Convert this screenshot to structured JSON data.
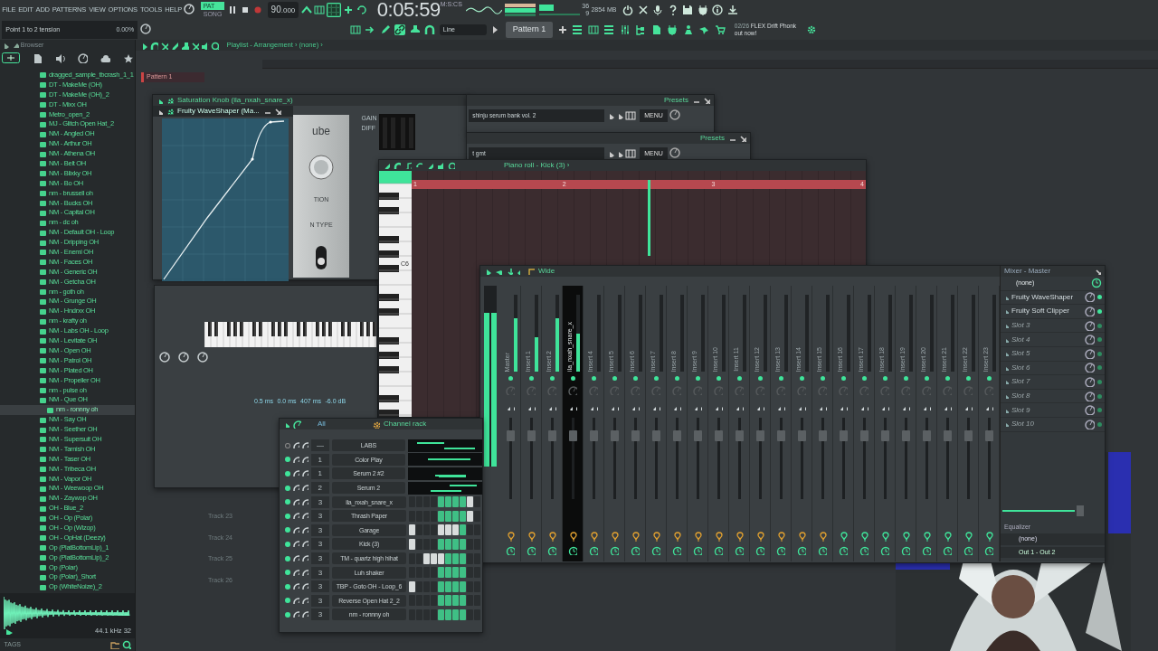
{
  "menu": [
    "FILE",
    "EDIT",
    "ADD",
    "PATTERNS",
    "VIEW",
    "OPTIONS",
    "TOOLS",
    "HELP"
  ],
  "transport": {
    "mode_pattern": "PAT",
    "mode_song": "SONG",
    "pattern_mode": true,
    "recording": false,
    "tempo": "90",
    "tempo_decimals": ".000",
    "time": "0:05:59",
    "time_unit": "M:S:CS",
    "cpu": "36",
    "memory": "2854 MB",
    "polyphony": "9"
  },
  "hint": {
    "title": "Point 1 to 2 tension",
    "value": "0.00%"
  },
  "snap": "Line",
  "pattern": "Pattern 1",
  "news": {
    "date": "02/26",
    "text": "FLEX Drift Phonk out now!"
  },
  "browser": {
    "title": "Browser",
    "items": [
      {
        "name": "dragged_sample_tbcrash_1_1",
        "selected": false
      },
      {
        "name": "DT - MakeMe (OH)",
        "selected": false
      },
      {
        "name": "DT - MakeMe (OH)_2",
        "selected": false
      },
      {
        "name": "DT - Mixx OH",
        "selected": false
      },
      {
        "name": "Metro_open_2",
        "selected": false
      },
      {
        "name": "MJ - Glitch Open Hat_2",
        "selected": false
      },
      {
        "name": "NM - Angled OH",
        "selected": false
      },
      {
        "name": "NM - Arthur OH",
        "selected": false
      },
      {
        "name": "NM - Athena OH",
        "selected": false
      },
      {
        "name": "NM - Belt OH",
        "selected": false
      },
      {
        "name": "NM - Blixky OH",
        "selected": false
      },
      {
        "name": "NM - Bo OH",
        "selected": false
      },
      {
        "name": "nm - brussell oh",
        "selected": false
      },
      {
        "name": "NM - Bucks OH",
        "selected": false
      },
      {
        "name": "NM - Capital OH",
        "selected": false
      },
      {
        "name": "nm - dc oh",
        "selected": false
      },
      {
        "name": "NM - Default OH - Loop",
        "selected": false
      },
      {
        "name": "NM - Dripping OH",
        "selected": false
      },
      {
        "name": "NM - Enemi OH",
        "selected": false
      },
      {
        "name": "NM - Faces OH",
        "selected": false
      },
      {
        "name": "NM - Generic OH",
        "selected": false
      },
      {
        "name": "NM - Getcha OH",
        "selected": false
      },
      {
        "name": "nm - goth oh",
        "selected": false
      },
      {
        "name": "NM - Grunge OH",
        "selected": false
      },
      {
        "name": "NM - Hndrxx OH",
        "selected": false
      },
      {
        "name": "nm - krafty oh",
        "selected": false
      },
      {
        "name": "NM - Labs OH - Loop",
        "selected": false
      },
      {
        "name": "NM - Levitate OH",
        "selected": false
      },
      {
        "name": "NM - Open OH",
        "selected": false
      },
      {
        "name": "NM - Patrol OH",
        "selected": false
      },
      {
        "name": "NM - Plated OH",
        "selected": false
      },
      {
        "name": "NM - Propeller OH",
        "selected": false
      },
      {
        "name": "nm - pulse oh",
        "selected": false
      },
      {
        "name": "NM - Que OH",
        "selected": false
      },
      {
        "name": "nm - ronnny oh",
        "selected": true
      },
      {
        "name": "NM - Say OH",
        "selected": false
      },
      {
        "name": "NM - Seether OH",
        "selected": false
      },
      {
        "name": "NM - Supersuit OH",
        "selected": false
      },
      {
        "name": "NM - Tarnish OH",
        "selected": false
      },
      {
        "name": "NM - Taser OH",
        "selected": false
      },
      {
        "name": "NM - Tribeca OH",
        "selected": false
      },
      {
        "name": "NM - Vapor OH",
        "selected": false
      },
      {
        "name": "NM - Weewoop OH",
        "selected": false
      },
      {
        "name": "NM - Zaywop OH",
        "selected": false
      },
      {
        "name": "OH - Blue_2",
        "selected": false
      },
      {
        "name": "OH - Op (Polar)",
        "selected": false
      },
      {
        "name": "OH - Op (Wizop)",
        "selected": false
      },
      {
        "name": "OH - OpHat (Deezy)",
        "selected": false
      },
      {
        "name": "Op (PlatBottomLip)_1",
        "selected": false
      },
      {
        "name": "Op (PlatBottomLip)_2",
        "selected": false
      },
      {
        "name": "Op (Polar)",
        "selected": false
      },
      {
        "name": "Op (Polar)_Short",
        "selected": false
      },
      {
        "name": "Op (WhiteNoize)_2",
        "selected": false
      }
    ],
    "sample_rate": "44.1 kHz 32",
    "tags": "TAGS"
  },
  "playlist": {
    "title": "Playlist - Arrangement ›",
    "breadcrumb": "(none) ›",
    "clip": "Pattern 1",
    "tracks": [
      "Track 23",
      "Track 24",
      "Track 25",
      "Track 26"
    ]
  },
  "waveshaper": {
    "title": "Saturation Knob (ila_nxah_snare_x)",
    "plugin": "Fruity WaveShaper (Ma...",
    "panel_texts": [
      "ube",
      "TION",
      "N TYPE"
    ],
    "meter_labels": [
      "GAIN",
      "DIFF"
    ]
  },
  "presets": [
    {
      "title": "Presets",
      "menu": "MENU",
      "preset": "shinju serum bank vol. 2"
    },
    {
      "title": "Presets",
      "menu": "MENU",
      "preset": "t gmt"
    }
  ],
  "piano_roll": {
    "title": "Piano roll - Kick (3) ›",
    "bars": [
      "1",
      "2",
      "3",
      "4"
    ],
    "key_label": "C6"
  },
  "envelope": {
    "values": [
      "0.5 ms",
      "0.0 ms",
      "407 ms",
      "-6.0 dB"
    ]
  },
  "mixer": {
    "title": "Wide",
    "panel_title": "Mixer - Master",
    "output_meter": {
      "level": 0.85
    },
    "strips": [
      {
        "name": "Master",
        "level": 0.7,
        "selected": false,
        "routed": true
      },
      {
        "name": "Insert 1",
        "level": 0.45,
        "selected": false,
        "routed": true
      },
      {
        "name": "Insert 2",
        "level": 0.7,
        "selected": false,
        "routed": true
      },
      {
        "name": "ila_nxah_snare_x",
        "level": 0.5,
        "selected": true,
        "routed": true
      },
      {
        "name": "Insert 4",
        "level": 0,
        "selected": false,
        "routed": true
      },
      {
        "name": "Insert 5",
        "level": 0,
        "selected": false,
        "routed": true
      },
      {
        "name": "Insert 6",
        "level": 0,
        "selected": false,
        "routed": true
      },
      {
        "name": "Insert 7",
        "level": 0,
        "selected": false,
        "routed": true
      },
      {
        "name": "Insert 8",
        "level": 0,
        "selected": false,
        "routed": true
      },
      {
        "name": "Insert 9",
        "level": 0,
        "selected": false,
        "routed": true
      },
      {
        "name": "Insert 10",
        "level": 0,
        "selected": false,
        "routed": true
      },
      {
        "name": "Insert 11",
        "level": 0,
        "selected": false,
        "routed": true
      },
      {
        "name": "Insert 12",
        "level": 0,
        "selected": false,
        "routed": true
      },
      {
        "name": "Insert 13",
        "level": 0,
        "selected": false,
        "routed": true
      },
      {
        "name": "Insert 14",
        "level": 0,
        "selected": false,
        "routed": true
      },
      {
        "name": "Insert 15",
        "level": 0,
        "selected": false,
        "routed": true
      },
      {
        "name": "Insert 16",
        "level": 0,
        "selected": false,
        "routed": false
      },
      {
        "name": "Insert 17",
        "level": 0,
        "selected": false,
        "routed": false
      },
      {
        "name": "Insert 18",
        "level": 0,
        "selected": false,
        "routed": false
      },
      {
        "name": "Insert 19",
        "level": 0,
        "selected": false,
        "routed": false
      },
      {
        "name": "Insert 20",
        "level": 0,
        "selected": false,
        "routed": false
      },
      {
        "name": "Insert 21",
        "level": 0,
        "selected": false,
        "routed": false
      },
      {
        "name": "Insert 22",
        "level": 0,
        "selected": false,
        "routed": false
      },
      {
        "name": "Insert 23",
        "level": 0,
        "selected": false,
        "routed": false
      }
    ],
    "input": "(none)",
    "slots": [
      {
        "name": "Fruity WaveShaper",
        "active": true
      },
      {
        "name": "Fruity Soft Clipper",
        "active": true
      },
      {
        "name": "Slot 3",
        "active": false
      },
      {
        "name": "Slot 4",
        "active": false
      },
      {
        "name": "Slot 5",
        "active": false
      },
      {
        "name": "Slot 6",
        "active": false
      },
      {
        "name": "Slot 7",
        "active": false
      },
      {
        "name": "Slot 8",
        "active": false
      },
      {
        "name": "Slot 9",
        "active": false
      },
      {
        "name": "Slot 10",
        "active": false
      }
    ],
    "eq": "Equalizer",
    "output_in": "(none)",
    "output": "Out 1 - Out 2"
  },
  "channel_rack": {
    "title": "Channel rack",
    "filter": "All",
    "channels": [
      {
        "number": "—",
        "name": "LABS",
        "kind": "roll",
        "enabled": false
      },
      {
        "number": "1",
        "name": "Color Play",
        "kind": "roll",
        "enabled": true
      },
      {
        "number": "1",
        "name": "Serum 2 #2",
        "kind": "roll",
        "enabled": true
      },
      {
        "number": "2",
        "name": "Serum 2",
        "kind": "roll",
        "enabled": true
      },
      {
        "number": "3",
        "name": "ila_nxah_snare_x",
        "kind": "steps",
        "enabled": true,
        "steps": [
          false,
          false,
          false,
          false,
          true,
          true,
          true,
          true,
          true,
          false
        ],
        "accents": [
          false,
          false,
          false,
          false,
          false,
          false,
          false,
          false,
          true,
          false
        ]
      },
      {
        "number": "3",
        "name": "Thrash Paper",
        "kind": "steps",
        "enabled": true,
        "steps": [
          false,
          false,
          false,
          false,
          true,
          true,
          true,
          true,
          true,
          false
        ],
        "accents": [
          false,
          false,
          false,
          false,
          false,
          false,
          false,
          false,
          true,
          false
        ]
      },
      {
        "number": "3",
        "name": "Garage",
        "kind": "steps",
        "enabled": true,
        "steps": [
          true,
          false,
          false,
          false,
          true,
          true,
          true,
          true,
          false,
          false
        ],
        "accents": [
          true,
          false,
          false,
          false,
          true,
          true,
          true,
          false,
          false,
          false
        ]
      },
      {
        "number": "3",
        "name": "Kick (3)",
        "kind": "steps",
        "enabled": true,
        "steps": [
          true,
          false,
          false,
          false,
          true,
          true,
          true,
          true,
          false,
          false
        ],
        "accents": [
          true,
          false,
          false,
          false,
          false,
          false,
          false,
          false,
          false,
          false
        ]
      },
      {
        "number": "3",
        "name": "TM - quartz high hihat",
        "kind": "steps",
        "enabled": true,
        "steps": [
          false,
          false,
          true,
          true,
          true,
          true,
          true,
          true,
          false,
          false
        ],
        "accents": [
          false,
          false,
          true,
          true,
          true,
          false,
          false,
          false,
          false,
          false
        ]
      },
      {
        "number": "3",
        "name": "Luh shaker",
        "kind": "steps",
        "enabled": true,
        "steps": [
          false,
          false,
          false,
          false,
          true,
          true,
          true,
          true,
          false,
          false
        ],
        "accents": [
          false,
          false,
          false,
          false,
          false,
          false,
          false,
          false,
          false,
          false
        ]
      },
      {
        "number": "3",
        "name": "TBP - Goto OH - Loop_6",
        "kind": "steps",
        "enabled": true,
        "steps": [
          true,
          false,
          false,
          false,
          true,
          true,
          true,
          true,
          false,
          false
        ],
        "accents": [
          true,
          false,
          false,
          false,
          false,
          false,
          false,
          false,
          false,
          false
        ]
      },
      {
        "number": "3",
        "name": "Reverse Open Hat 2_2",
        "kind": "steps",
        "enabled": true,
        "steps": [
          false,
          false,
          false,
          false,
          true,
          true,
          true,
          true,
          false,
          false
        ],
        "accents": [
          false,
          false,
          false,
          false,
          false,
          false,
          false,
          false,
          false,
          false
        ]
      },
      {
        "number": "3",
        "name": "nm - ronnny oh",
        "kind": "steps",
        "enabled": true,
        "steps": [
          false,
          false,
          false,
          false,
          true,
          true,
          true,
          true,
          false,
          false
        ],
        "accents": [
          false,
          false,
          false,
          false,
          false,
          false,
          false,
          false,
          false,
          false
        ]
      }
    ]
  }
}
